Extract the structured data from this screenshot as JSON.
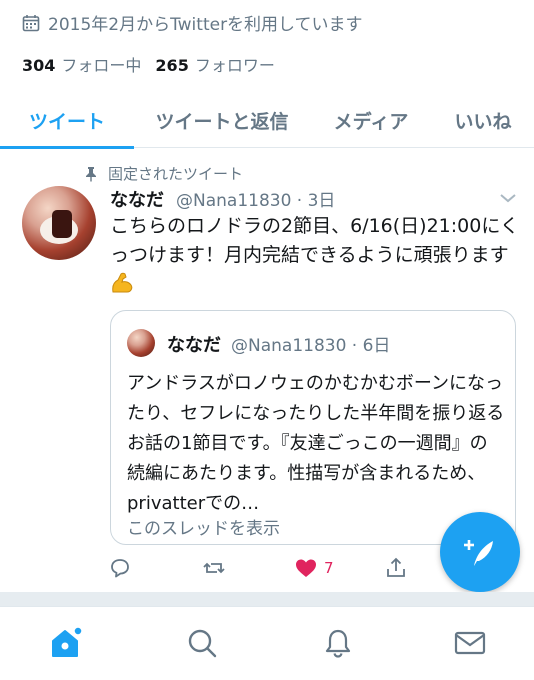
{
  "profile": {
    "joined": "2015年2月からTwitterを利用しています",
    "following_count": "304",
    "following_label": "フォロー中",
    "followers_count": "265",
    "followers_label": "フォロワー"
  },
  "tabs": [
    {
      "label": "ツイート",
      "active": true
    },
    {
      "label": "ツイートと返信",
      "active": false
    },
    {
      "label": "メディア",
      "active": false
    },
    {
      "label": "いいね",
      "active": false
    }
  ],
  "tweet": {
    "pinned_label": "固定されたツイート",
    "name": "ななだ",
    "handle_time": "@Nana11830 · 3日",
    "text": "こちらのロノドラの2節目、6/16(日)21:00にくっつけます！月内完結できるように頑張ります",
    "emoji": "flexed-biceps",
    "quote": {
      "name": "ななだ",
      "handle_time": "@Nana11830 · 6日",
      "text": "アンドラスがロノウェのかむかむボーンになったり、セフレになったりした半年間を振り返るお話の1節目です。『友達ごっこの一週間』の続編にあたります。性描写が含まれるため、privatterでの…",
      "thread_link": "このスレッドを表示"
    },
    "actions": {
      "reply": "",
      "retweet": "",
      "like_count": "7",
      "share": ""
    }
  },
  "colors": {
    "accent": "#1da1f2",
    "like": "#e0245e",
    "muted": "#657786"
  },
  "bottom_nav": [
    "home-icon",
    "search-icon",
    "notifications-icon",
    "messages-icon"
  ]
}
